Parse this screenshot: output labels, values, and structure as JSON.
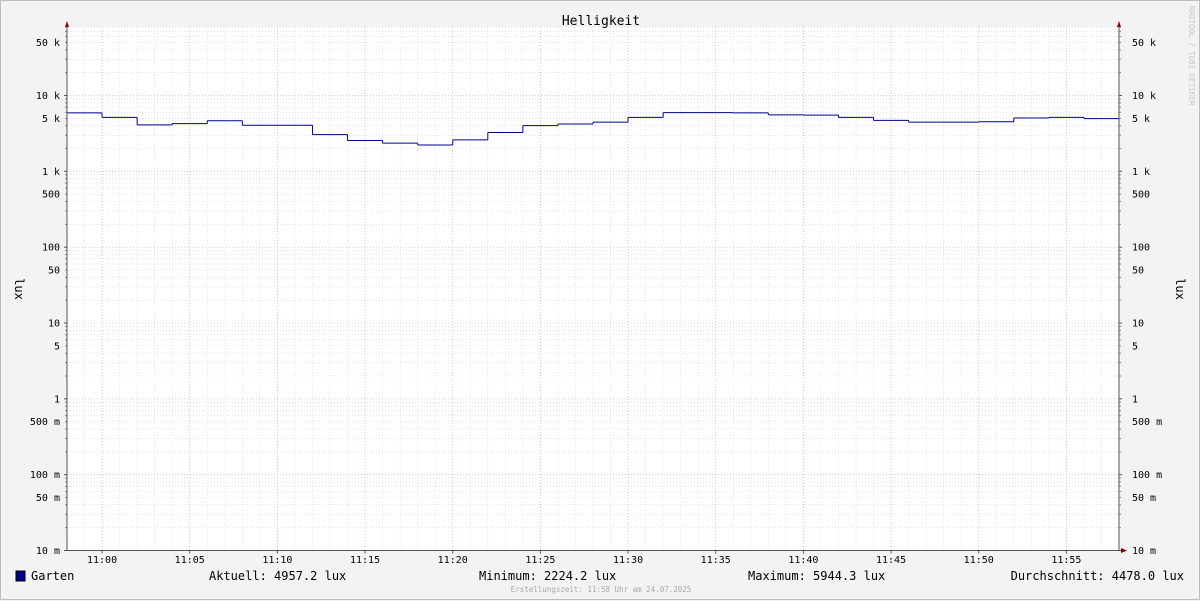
{
  "chart_data": {
    "type": "line",
    "title": "Helligkeit",
    "ylabel": "lux",
    "scale": "log",
    "ylim": [
      0.01,
      80000
    ],
    "xlim": [
      "10:58:00",
      "11:58:00"
    ],
    "x_ticks": [
      "11:00",
      "11:05",
      "11:10",
      "11:15",
      "11:20",
      "11:25",
      "11:30",
      "11:35",
      "11:40",
      "11:45",
      "11:50",
      "11:55"
    ],
    "y_ticks": [
      {
        "value": 50000,
        "label": "50 k"
      },
      {
        "value": 10000,
        "label": "10 k"
      },
      {
        "value": 5000,
        "label": "5 k"
      },
      {
        "value": 1000,
        "label": "1 k"
      },
      {
        "value": 500,
        "label": "500"
      },
      {
        "value": 100,
        "label": "100"
      },
      {
        "value": 50,
        "label": "50"
      },
      {
        "value": 10,
        "label": "10"
      },
      {
        "value": 5,
        "label": "5"
      },
      {
        "value": 1,
        "label": "1"
      },
      {
        "value": 0.5,
        "label": "500 m"
      },
      {
        "value": 0.1,
        "label": "100 m"
      },
      {
        "value": 0.05,
        "label": "50 m"
      },
      {
        "value": 0.01,
        "label": "10 m"
      }
    ],
    "grid": true,
    "legend_position": "bottom-left",
    "watermark": "RRDTOOL / TOBI OETIKER",
    "series": [
      {
        "name": "Garten",
        "color": "#00008b",
        "x": [
          "10:58:00",
          "11:00:00",
          "11:02:00",
          "11:04:00",
          "11:06:00",
          "11:08:00",
          "11:10:00",
          "11:12:00",
          "11:14:00",
          "11:16:00",
          "11:18:00",
          "11:20:00",
          "11:22:00",
          "11:24:00",
          "11:26:00",
          "11:28:00",
          "11:30:00",
          "11:32:00",
          "11:34:00",
          "11:36:00",
          "11:38:00",
          "11:40:00",
          "11:42:00",
          "11:44:00",
          "11:46:00",
          "11:48:00",
          "11:50:00",
          "11:52:00",
          "11:54:00",
          "11:56:00"
        ],
        "y": [
          5900,
          5150,
          4100,
          4250,
          4650,
          4050,
          4050,
          3050,
          2550,
          2350,
          2224.2,
          2600,
          3250,
          4000,
          4200,
          4450,
          5150,
          5944.3,
          5944.3,
          5900,
          5550,
          5500,
          5150,
          4700,
          4450,
          4450,
          4500,
          5050,
          5150,
          4957.2
        ]
      }
    ],
    "stats": {
      "current": "Aktuell: 4957.2 lux",
      "minimum": "Minimum: 2224.2 lux",
      "maximum": "Maximum: 5944.3 lux",
      "average": "Durchschnitt: 4478.0 lux"
    },
    "footer": "Erstellungszeit: 11:58 Uhr am 24.07.2025"
  }
}
